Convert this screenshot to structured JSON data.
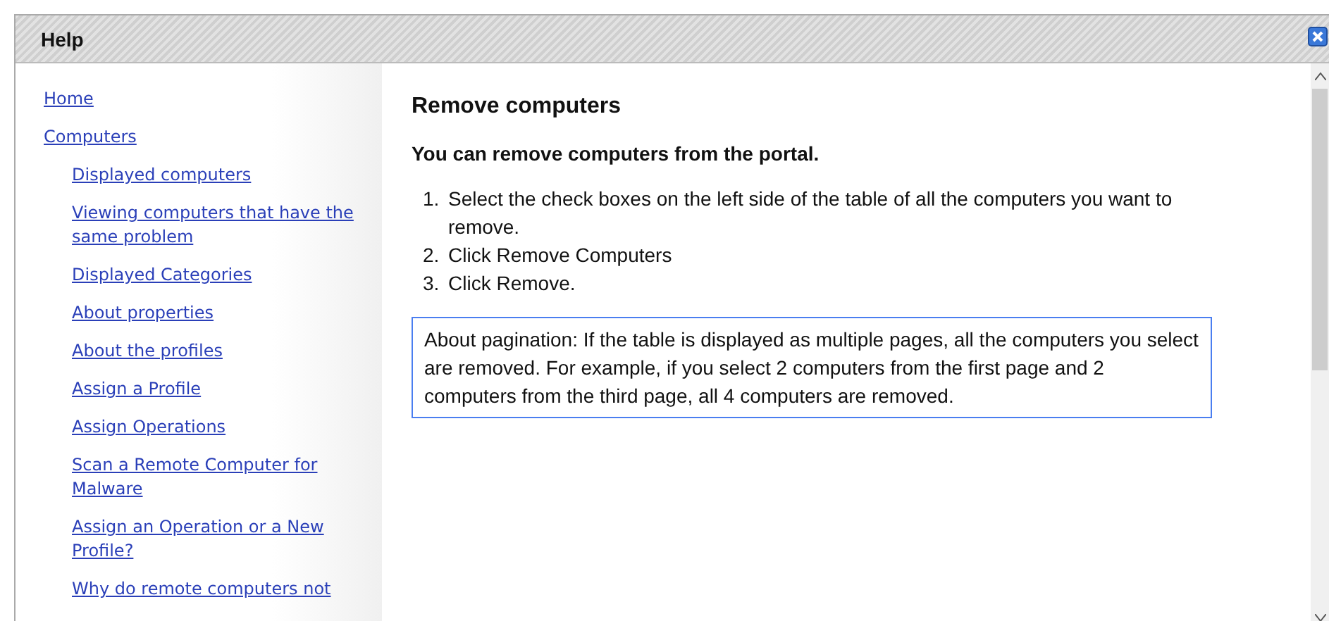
{
  "window": {
    "title": "Help"
  },
  "sidebar": {
    "items": [
      {
        "label": "Home"
      },
      {
        "label": "Computers",
        "children": [
          {
            "label": "Displayed computers"
          },
          {
            "label": "Viewing computers that have the same problem"
          },
          {
            "label": "Displayed Categories"
          },
          {
            "label": "About properties"
          },
          {
            "label": "About the profiles"
          },
          {
            "label": "Assign a Profile"
          },
          {
            "label": "Assign Operations"
          },
          {
            "label": "Scan a Remote Computer for Malware"
          },
          {
            "label": "Assign an Operation or a New Profile?"
          },
          {
            "label": "Why do remote computers not"
          }
        ]
      }
    ]
  },
  "content": {
    "heading": "Remove computers",
    "intro": "You can remove computers from the portal.",
    "steps": [
      {
        "number": "1.",
        "text": "Select the check boxes on the left side of the table of all the computers you want to remove."
      },
      {
        "number": "2.",
        "text": "Click Remove Computers"
      },
      {
        "number": "3.",
        "text": "Click Remove."
      }
    ],
    "note": "About pagination: If the table is displayed as multiple pages, all the computers you select are removed. For example, if you select 2 computers from the first page and 2 computers from the third page, all 4 computers are removed."
  }
}
